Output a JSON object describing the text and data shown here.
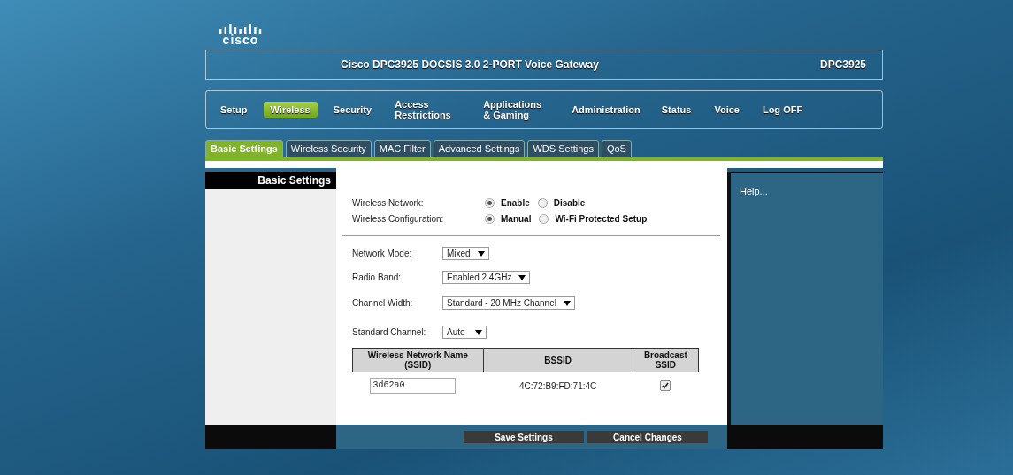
{
  "logo": "cisco",
  "header": {
    "title": "Cisco DPC3925 DOCSIS 3.0 2-PORT Voice Gateway",
    "model": "DPC3925"
  },
  "nav": [
    {
      "label": "Setup",
      "selected": false
    },
    {
      "label": "Wireless",
      "selected": true
    },
    {
      "label": "Security",
      "selected": false
    },
    {
      "label": "Access Restrictions",
      "selected": false
    },
    {
      "label": "Applications & Gaming",
      "selected": false
    },
    {
      "label": "Administration",
      "selected": false
    },
    {
      "label": "Status",
      "selected": false
    },
    {
      "label": "Voice",
      "selected": false
    },
    {
      "label": "Log OFF",
      "selected": false
    }
  ],
  "tabs": [
    {
      "label": "Basic Settings",
      "selected": true
    },
    {
      "label": "Wireless Security",
      "selected": false
    },
    {
      "label": "MAC Filter",
      "selected": false
    },
    {
      "label": "Advanced Settings",
      "selected": false
    },
    {
      "label": "WDS Settings",
      "selected": false
    },
    {
      "label": "QoS",
      "selected": false
    }
  ],
  "sidebar": {
    "title": "Basic Settings"
  },
  "radio_groups": [
    {
      "label": "Wireless Network:",
      "options": [
        {
          "label": "Enable",
          "selected": true
        },
        {
          "label": "Disable",
          "selected": false
        }
      ]
    },
    {
      "label": "Wireless Configuration:",
      "options": [
        {
          "label": "Manual",
          "selected": true
        },
        {
          "label": "Wi-Fi Protected Setup",
          "selected": false
        }
      ]
    }
  ],
  "selects": [
    {
      "label": "Network Mode:",
      "value": "Mixed"
    },
    {
      "label": "Radio Band:",
      "value": "Enabled 2.4GHz"
    },
    {
      "label": "Channel Width:",
      "value": "Standard - 20 MHz Channel"
    },
    {
      "label": "Standard Channel:",
      "value": "Auto"
    }
  ],
  "ssid_table": {
    "columns": [
      "Wireless Network Name (SSID)",
      "BSSID",
      "Broadcast SSID"
    ],
    "rows": [
      {
        "ssid": "3d62a0",
        "bssid": "4C:72:B9:FD:71:4C",
        "broadcast": true
      }
    ]
  },
  "help": "Help...",
  "buttons": [
    "Save Settings",
    "Cancel Changes"
  ]
}
